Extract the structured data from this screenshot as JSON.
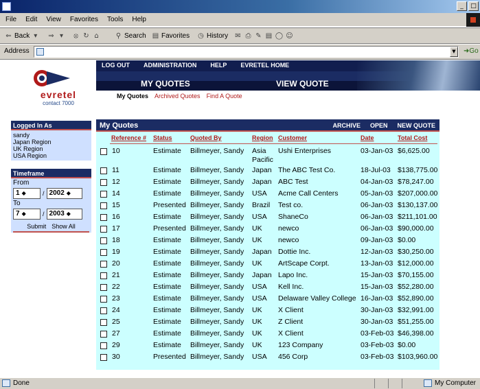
{
  "browser": {
    "window_controls": [
      "_",
      "□"
    ],
    "menu": [
      "File",
      "Edit",
      "View",
      "Favorites",
      "Tools",
      "Help"
    ],
    "toolbar": {
      "back_label": "Back",
      "search_label": "Search",
      "favorites_label": "Favorites",
      "history_label": "History"
    },
    "address_label": "Address",
    "go_label": "Go",
    "status": {
      "left": "Done",
      "right": "My Computer"
    }
  },
  "app": {
    "brand": "evretel",
    "brand_sub": "contact 7000",
    "top_nav": [
      "LOG OUT",
      "ADMINISTRATION",
      "HELP",
      "EVRETEL HOME"
    ],
    "tabs": {
      "my_quotes": "MY QUOTES",
      "view_quote": "VIEW QUOTE"
    },
    "sub_nav": [
      "My Quotes",
      "Archived Quotes",
      "Find A Quote"
    ]
  },
  "logged_in": {
    "heading": "Logged In As",
    "lines": [
      "sandy",
      "Japan Region",
      "UK Region",
      "USA Region"
    ]
  },
  "timeframe": {
    "heading": "Timeframe",
    "from_label": "From",
    "to_label": "To",
    "from_month": "1",
    "from_year": "2002",
    "to_month": "7",
    "to_year": "2003",
    "separator": "/",
    "submit_label": "Submit",
    "show_all_label": "Show All"
  },
  "quotes": {
    "title": "My Quotes",
    "actions": [
      "ARCHIVE",
      "OPEN",
      "NEW QUOTE"
    ],
    "columns": {
      "reference": "Reference #",
      "status": "Status",
      "quoted_by": "Quoted By",
      "region": "Region",
      "customer": "Customer",
      "date": "Date",
      "total": "Total Cost"
    },
    "rows": [
      {
        "ref": "10",
        "status": "Estimate",
        "quoted_by": "Billmeyer, Sandy",
        "region": "Asia Pacific",
        "customer": "Ushi Enterprises",
        "date": "03-Jan-03",
        "total": "$6,625.00"
      },
      {
        "ref": "11",
        "status": "Estimate",
        "quoted_by": "Billmeyer, Sandy",
        "region": "Japan",
        "customer": "The ABC Test Co.",
        "date": "18-Jul-03",
        "total": "$138,775.00"
      },
      {
        "ref": "12",
        "status": "Estimate",
        "quoted_by": "Billmeyer, Sandy",
        "region": "Japan",
        "customer": "ABC Test",
        "date": "04-Jan-03",
        "total": "$78,247.00"
      },
      {
        "ref": "14",
        "status": "Estimate",
        "quoted_by": "Billmeyer, Sandy",
        "region": "USA",
        "customer": "Acme Call Centers",
        "date": "05-Jan-03",
        "total": "$207,000.00"
      },
      {
        "ref": "15",
        "status": "Presented",
        "quoted_by": "Billmeyer, Sandy",
        "region": "Brazil",
        "customer": "Test co.",
        "date": "06-Jan-03",
        "total": "$130,137.00"
      },
      {
        "ref": "16",
        "status": "Estimate",
        "quoted_by": "Billmeyer, Sandy",
        "region": "USA",
        "customer": "ShaneCo",
        "date": "06-Jan-03",
        "total": "$211,101.00"
      },
      {
        "ref": "17",
        "status": "Presented",
        "quoted_by": "Billmeyer, Sandy",
        "region": "UK",
        "customer": "newco",
        "date": "06-Jan-03",
        "total": "$90,000.00"
      },
      {
        "ref": "18",
        "status": "Estimate",
        "quoted_by": "Billmeyer, Sandy",
        "region": "UK",
        "customer": "newco",
        "date": "09-Jan-03",
        "total": "$0.00"
      },
      {
        "ref": "19",
        "status": "Estimate",
        "quoted_by": "Billmeyer, Sandy",
        "region": "Japan",
        "customer": "Dottie Inc.",
        "date": "12-Jan-03",
        "total": "$30,250.00"
      },
      {
        "ref": "20",
        "status": "Estimate",
        "quoted_by": "Billmeyer, Sandy",
        "region": "UK",
        "customer": "ArtScape Corpt.",
        "date": "13-Jan-03",
        "total": "$12,000.00"
      },
      {
        "ref": "21",
        "status": "Estimate",
        "quoted_by": "Billmeyer, Sandy",
        "region": "Japan",
        "customer": "Lapo Inc.",
        "date": "15-Jan-03",
        "total": "$70,155.00"
      },
      {
        "ref": "22",
        "status": "Estimate",
        "quoted_by": "Billmeyer, Sandy",
        "region": "USA",
        "customer": "Kell Inc.",
        "date": "15-Jan-03",
        "total": "$52,280.00"
      },
      {
        "ref": "23",
        "status": "Estimate",
        "quoted_by": "Billmeyer, Sandy",
        "region": "USA",
        "customer": "Delaware Valley College",
        "date": "16-Jan-03",
        "total": "$52,890.00"
      },
      {
        "ref": "24",
        "status": "Estimate",
        "quoted_by": "Billmeyer, Sandy",
        "region": "UK",
        "customer": "X Client",
        "date": "30-Jan-03",
        "total": "$32,991.00"
      },
      {
        "ref": "25",
        "status": "Estimate",
        "quoted_by": "Billmeyer, Sandy",
        "region": "UK",
        "customer": "Z Client",
        "date": "30-Jan-03",
        "total": "$51,255.00"
      },
      {
        "ref": "27",
        "status": "Estimate",
        "quoted_by": "Billmeyer, Sandy",
        "region": "UK",
        "customer": "X Client",
        "date": "03-Feb-03",
        "total": "$46,398.00"
      },
      {
        "ref": "29",
        "status": "Estimate",
        "quoted_by": "Billmeyer, Sandy",
        "region": "UK",
        "customer": "123 Company",
        "date": "03-Feb-03",
        "total": "$0.00"
      },
      {
        "ref": "30",
        "status": "Presented",
        "quoted_by": "Billmeyer, Sandy",
        "region": "USA",
        "customer": "456 Corp",
        "date": "03-Feb-03",
        "total": "$103,960.00"
      }
    ]
  },
  "colors": {
    "nav_dark": "#111e4f",
    "panel_blue": "#cfe0ff",
    "grid_bg": "#ccffff",
    "accent_red": "#b01a1a"
  }
}
